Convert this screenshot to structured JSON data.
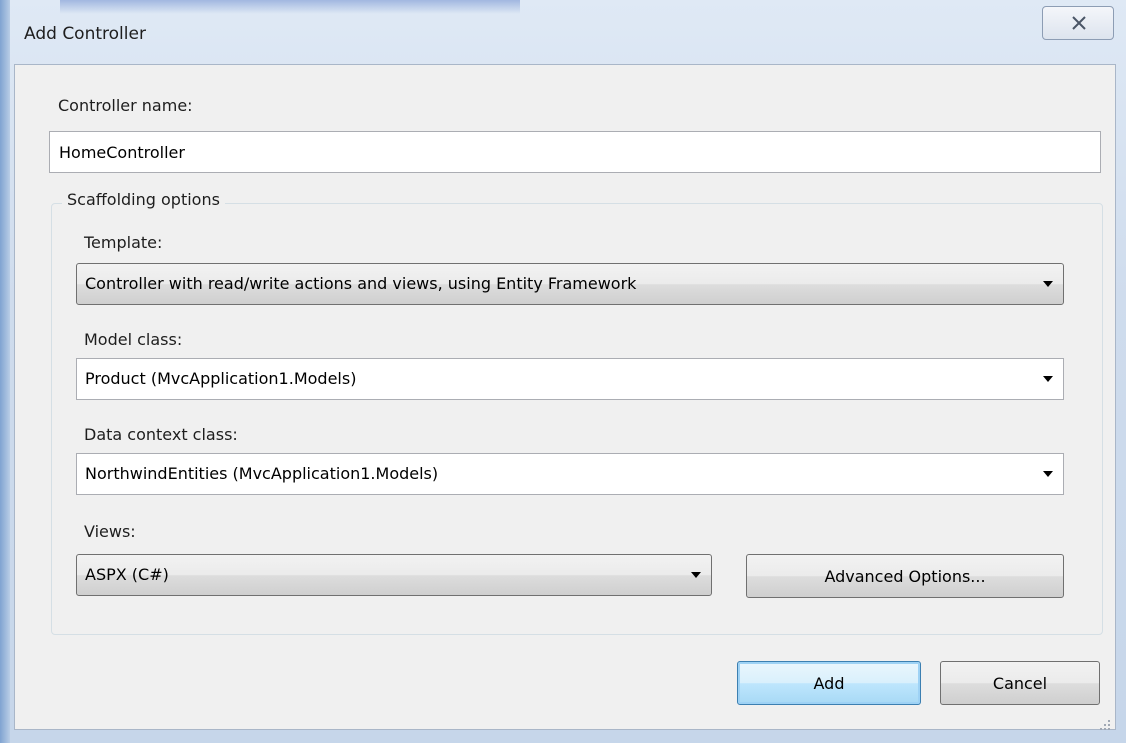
{
  "window": {
    "title": "Add Controller"
  },
  "form": {
    "controller_name_label": "Controller name:",
    "controller_name_value": "HomeController",
    "scaffolding_label": "Scaffolding options",
    "template_label": "Template:",
    "template_value": "Controller with read/write actions and views, using Entity Framework",
    "model_class_label": "Model class:",
    "model_class_value": "Product (MvcApplication1.Models)",
    "data_context_label": "Data context class:",
    "data_context_value": "NorthwindEntities (MvcApplication1.Models)",
    "views_label": "Views:",
    "views_value": "ASPX (C#)",
    "advanced_options_label": "Advanced Options..."
  },
  "buttons": {
    "add_label": "Add",
    "cancel_label": "Cancel"
  },
  "icons": {
    "close": "close-icon",
    "dropdown": "chevron-down-icon",
    "resize": "resize-grip-icon"
  }
}
